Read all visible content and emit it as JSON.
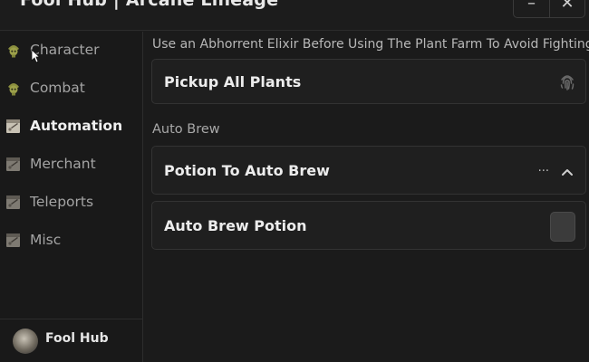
{
  "window": {
    "title": "Fool Hub | Arcane Lineage"
  },
  "title_buttons": {
    "minimize": "–",
    "close": "✕"
  },
  "sidebar": {
    "items": [
      {
        "label": "Character",
        "icon": "leaf-skull-icon",
        "active": false
      },
      {
        "label": "Combat",
        "icon": "leaf-skull-icon",
        "active": false
      },
      {
        "label": "Automation",
        "icon": "scroll-icon",
        "active": true
      },
      {
        "label": "Merchant",
        "icon": "scroll-icon",
        "active": false
      },
      {
        "label": "Teleports",
        "icon": "scroll-icon",
        "active": false
      },
      {
        "label": "Misc",
        "icon": "scroll-icon",
        "active": false
      }
    ],
    "profile": {
      "name": "Fool Hub"
    }
  },
  "main": {
    "paragraph": "Use an Abhorrent Elixir Before Using The Plant Farm To Avoid Fighting",
    "pickup_button": {
      "label": "Pickup All Plants",
      "icon": "fingerprint-icon"
    },
    "section_label": "Auto Brew",
    "dropdown": {
      "label": "Potion To Auto Brew",
      "value": "...",
      "icon": "chevron-up-icon"
    },
    "toggle": {
      "label": "Auto Brew Potion",
      "enabled": false
    }
  },
  "colors": {
    "background": "#1b1b1b",
    "card": "#1f1f1f",
    "border": "#333333",
    "text": "#ececec",
    "muted": "#a4a4a4"
  }
}
